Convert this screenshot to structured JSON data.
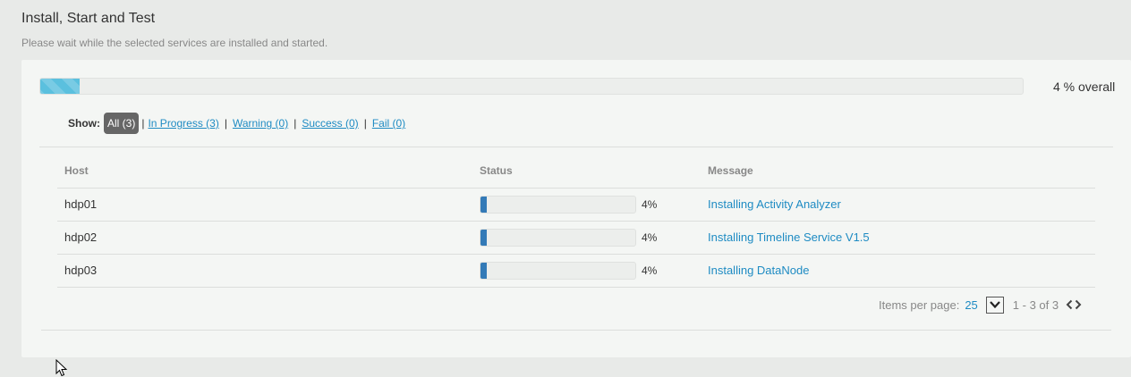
{
  "page": {
    "title": "Install, Start and Test",
    "subtitle": "Please wait while the selected services are installed and started."
  },
  "overall": {
    "progress_percent": 4,
    "label": "4 % overall",
    "color": "#5bc0de"
  },
  "filters": {
    "show_label": "Show:",
    "items": [
      {
        "label": "All (3)",
        "active": true
      },
      {
        "label": "In Progress (3)",
        "active": false
      },
      {
        "label": "Warning (0)",
        "active": false
      },
      {
        "label": "Success (0)",
        "active": false
      },
      {
        "label": "Fail (0)",
        "active": false
      }
    ]
  },
  "table": {
    "headers": {
      "host": "Host",
      "status": "Status",
      "message": "Message"
    },
    "rows": [
      {
        "host": "hdp01",
        "progress_percent": 4,
        "progress_label": "4%",
        "message": "Installing Activity Analyzer"
      },
      {
        "host": "hdp02",
        "progress_percent": 4,
        "progress_label": "4%",
        "message": "Installing Timeline Service V1.5"
      },
      {
        "host": "hdp03",
        "progress_percent": 4,
        "progress_label": "4%",
        "message": "Installing DataNode"
      }
    ],
    "bar_color": "#337ab7"
  },
  "pagination": {
    "items_per_page_label": "Items per page:",
    "items_per_page_value": "25",
    "range_label": "1 - 3 of 3",
    "prev_icon": "chevron-left-icon",
    "next_icon": "chevron-right-icon"
  },
  "colors": {
    "link": "#1e8bc3",
    "background": "#e8eae8",
    "panel": "#f4f6f4"
  }
}
